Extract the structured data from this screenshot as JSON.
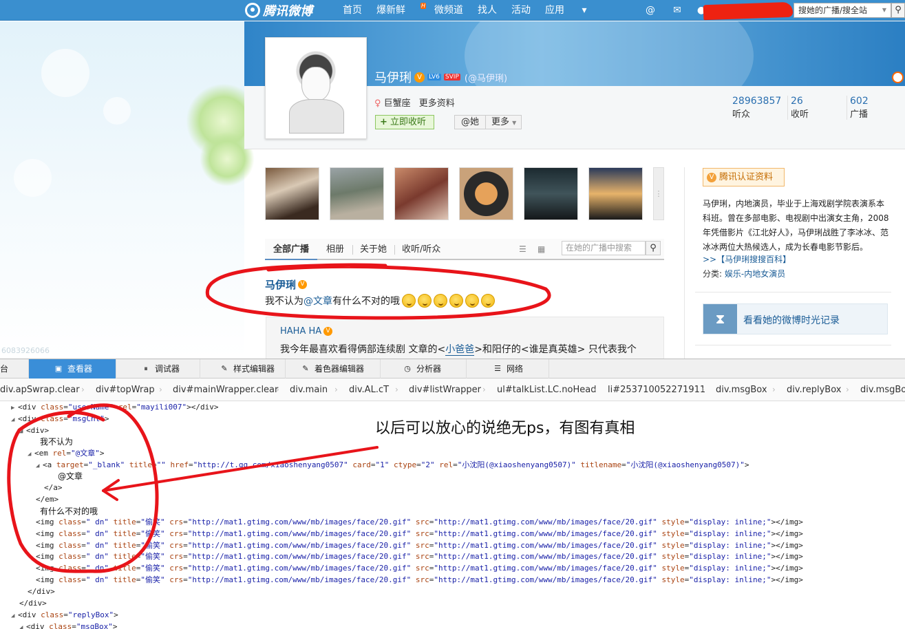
{
  "topnav": {
    "logo_text": "腾讯微博",
    "links": [
      "首页",
      "爆新鲜",
      "微频道",
      "找人",
      "活动",
      "应用"
    ],
    "hot_badge": "H",
    "search_placeholder": "搜她的广播/搜全站",
    "icons": [
      "at-icon",
      "mail-icon",
      "user-icon",
      "search-icon"
    ]
  },
  "watermark_number": "6083926066",
  "profile": {
    "name": "马伊琍",
    "level": "LV6",
    "vip": "SVIP",
    "handle": "(@马伊琍)",
    "zodiac": "巨蟹座",
    "more_info": "更多资料",
    "follow_label": "立即收听",
    "at_label": "@她",
    "more_label": "更多",
    "stats": [
      {
        "value": "28963857",
        "label": "听众"
      },
      {
        "value": "26",
        "label": "收听"
      },
      {
        "value": "602",
        "label": "广播"
      }
    ]
  },
  "tabs": {
    "items": [
      "全部广播",
      "相册",
      "关于她",
      "收听/听众"
    ],
    "search_placeholder": "在她的广播中搜索"
  },
  "post": {
    "author": "马伊琍",
    "text_before": "我不认为",
    "mention": "@文章",
    "text_after": "有什么不对的哦",
    "emoji_title": "偷笑",
    "emoji_count": 6
  },
  "reply": {
    "author": "HAHA HA",
    "text_1": "我今年最喜欢看得俩部连续剧 文章的<",
    "link": "小爸爸",
    "text_2": ">和阳仔的<谁是真英雄> 只代表我个"
  },
  "sidebar": {
    "cert_label": "腾讯认证资料",
    "bio": "马伊琍，内地演员，毕业于上海戏剧学院表演系本科班。曾在多部电影、电视剧中出演女主角，2008年凭借影片《江北好人》，马伊琍战胜了李冰冰、范冰冰两位大热候选人，成为长春电影节影后。",
    "baike_link": ">>【马伊琍搜搜百科】",
    "category_label": "分类:",
    "category_value": "娱乐-内地女演员",
    "timeline_label": "看看她的微博时光记录"
  },
  "devtools": {
    "first_tab_fragment": "台",
    "tabs": [
      "查看器",
      "调试器",
      "样式编辑器",
      "着色器编辑器",
      "分析器",
      "网络"
    ],
    "active_tab": "查看器",
    "breadcrumbs": [
      "div.apSwrap.clear",
      "div#topWrap",
      "div#mainWrapper.clear",
      "div.main",
      "div.AL.cT",
      "div#listWrapper",
      "ul#talkList.LC.noHead",
      "li#253710052271911",
      "div.msgBox",
      "div.replyBox",
      "div.msgBox"
    ],
    "username_line": {
      "class": "userName",
      "rel": "mayili007"
    },
    "msg_cnt_class": "msgCnt",
    "text_1": "我不认为",
    "em_rel": "@文章",
    "a_target": "_blank",
    "a_title": "",
    "a_href": "http://t.qq.com/xiaoshenyang0507",
    "a_card": "1",
    "a_ctype": "2",
    "a_rel": "小沈阳(@xiaoshenyang0507)",
    "a_titlename": "小沈阳(@xiaoshenyang0507)",
    "a_text": "@文章",
    "text_2": "有什么不对的哦",
    "img_class": " dn",
    "img_title": "偷笑",
    "img_crs": "http://mat1.gtimg.com/www/mb/images/face/20.gif",
    "img_src": "http://mat1.gtimg.com/www/mb/images/face/20.gif",
    "img_style": "display: inline;",
    "img_rows": 6,
    "reply_box_class": "replyBox",
    "msg_box_class": "msgBox"
  },
  "annotation": {
    "caption": "以后可以放心的说绝无ps，有图有真相",
    "mark_color": "#e8141a"
  }
}
